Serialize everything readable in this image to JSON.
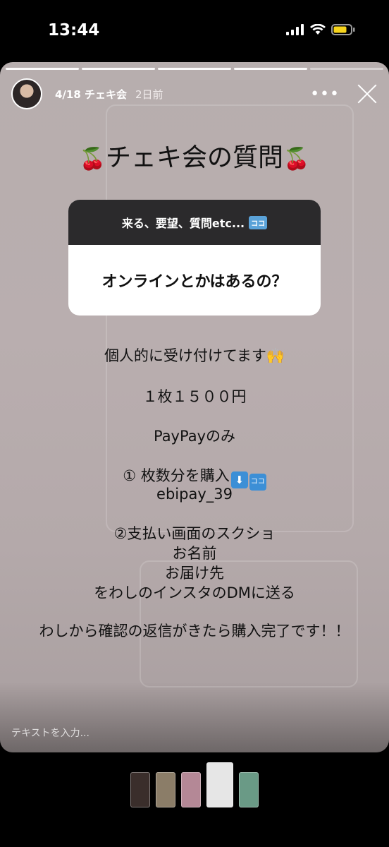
{
  "status_bar": {
    "time": "13:44"
  },
  "story": {
    "progress_segments": 5,
    "progress_done": 4,
    "title": "4/18 チェキ会",
    "time_ago": "2日前",
    "more_label": "•••",
    "headline": "チェキ会の質問",
    "question_box": {
      "prompt": "来る、要望、質問etc...",
      "prompt_badge": "ココ",
      "question": "オンラインとかはあるの？"
    },
    "lines": [
      {
        "text": "個人的に受け付けてます",
        "emoji": "🙌"
      },
      {
        "text": "１枚１５００円"
      },
      {
        "text": "PayPayのみ"
      },
      {
        "text": "① 枚数分を購入",
        "badges": [
          "⬇",
          "ココ"
        ]
      },
      {
        "text": "ebipay_39"
      },
      {
        "text": "②支払い画面のスクショ"
      },
      {
        "text": "お名前"
      },
      {
        "text": "お届け先"
      },
      {
        "text": "をわしのインスタのDMに送る"
      },
      {
        "text": "わしから確認の返信がきたら購入完了です！！"
      }
    ],
    "reply_placeholder": "テキストを入力..."
  },
  "colors": {
    "story_bg": "#b8aeae",
    "question_header": "#2b2a2c",
    "badge_blue": "#3c8fd6"
  },
  "thumbnails": [
    {
      "label": "thumb-1",
      "color": "#3a2e2b"
    },
    {
      "label": "thumb-2",
      "color": "#8b7d68"
    },
    {
      "label": "thumb-3",
      "color": "#b48896"
    },
    {
      "label": "thumb-4",
      "color": "#e6e6e6",
      "active": true
    },
    {
      "label": "thumb-5",
      "color": "#6a9a86"
    }
  ]
}
